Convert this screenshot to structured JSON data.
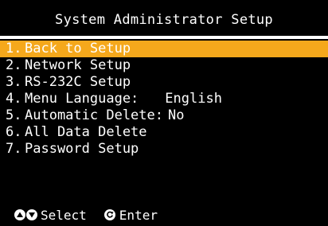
{
  "title": "System Administrator Setup",
  "menu": {
    "items": [
      {
        "num": "1.",
        "label": "Back to Setup",
        "selected": true
      },
      {
        "num": "2.",
        "label": "Network Setup"
      },
      {
        "num": "3.",
        "label": "RS-232C Setup"
      },
      {
        "num": "4.",
        "label": "Menu Language:",
        "value": "English"
      },
      {
        "num": "5.",
        "label": "Automatic Delete:",
        "value": "No"
      },
      {
        "num": "6.",
        "label": "All Data Delete"
      },
      {
        "num": "7.",
        "label": "Password Setup"
      }
    ]
  },
  "footer": {
    "select_label": "Select",
    "enter_label": "Enter",
    "icons": [
      "up-arrow-icon",
      "down-arrow-icon",
      "enter-icon"
    ]
  },
  "colors": {
    "background": "#000000",
    "text": "#ffffff",
    "highlight": "#f5a81c"
  }
}
